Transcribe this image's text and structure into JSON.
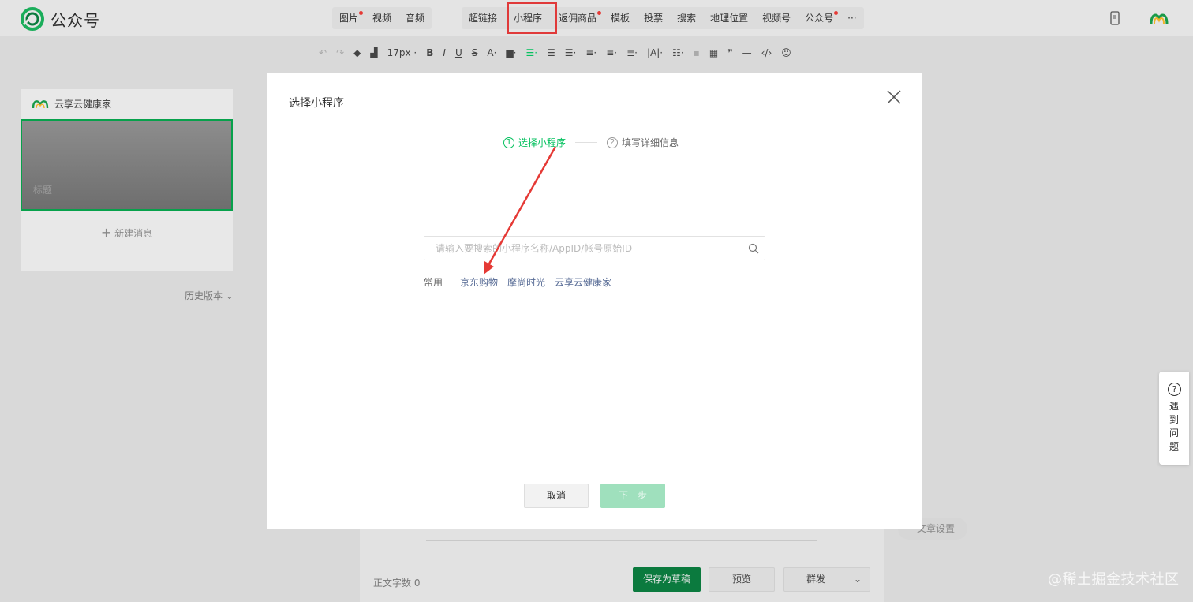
{
  "header": {
    "logo_text": "公众号",
    "toolbar_items": [
      {
        "label": "图片",
        "dot": true
      },
      {
        "label": "视频",
        "dot": false
      },
      {
        "label": "音频",
        "dot": false
      }
    ],
    "toolbar_items_2": [
      {
        "label": "超链接",
        "dot": false
      },
      {
        "label": "小程序",
        "dot": false
      },
      {
        "label": "返佣商品",
        "dot": true
      },
      {
        "label": "模板",
        "dot": false
      },
      {
        "label": "投票",
        "dot": false
      },
      {
        "label": "搜索",
        "dot": false
      },
      {
        "label": "地理位置",
        "dot": false
      },
      {
        "label": "视频号",
        "dot": false
      },
      {
        "label": "公众号",
        "dot": true
      },
      {
        "label": "···",
        "dot": false
      }
    ]
  },
  "format_bar": {
    "font_size": "17px"
  },
  "left_panel": {
    "account_name": "云享云健康家",
    "cover_title_placeholder": "标题",
    "new_message": "新建消息",
    "history": "历史版本"
  },
  "editor": {
    "word_count_label": "正文字数",
    "word_count_value": "0",
    "save_draft": "保存为草稿",
    "preview": "预览",
    "mass_send": "群发",
    "article_settings": "文章设置"
  },
  "watermark": "@稀土掘金技术社区",
  "help": {
    "text": "遇到问题"
  },
  "modal": {
    "title": "选择小程序",
    "steps": [
      {
        "num": "1",
        "label": "选择小程序"
      },
      {
        "num": "2",
        "label": "填写详细信息"
      }
    ],
    "search_placeholder": "请输入要搜索的小程序名称/AppID/帐号原始ID",
    "common_label": "常用",
    "common_items": [
      "京东购物",
      "摩尚时光",
      "云享云健康家"
    ],
    "cancel": "取消",
    "next": "下一步"
  },
  "colors": {
    "brand_green": "#07c160",
    "link_blue": "#576b95",
    "annotation_red": "#e03a3a"
  }
}
